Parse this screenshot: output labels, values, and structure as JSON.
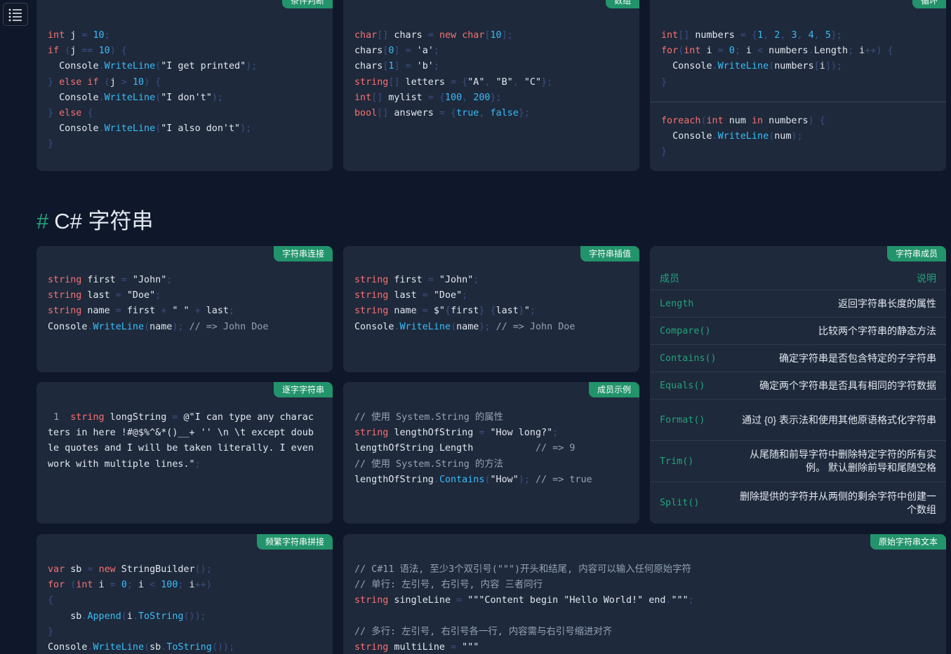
{
  "toolbar": {
    "toc_icon": "list-icon"
  },
  "cards": {
    "conditional": {
      "tag": "条件判断"
    },
    "arrays": {
      "tag": "数组"
    },
    "loops": {
      "tag": "循环"
    },
    "concat": {
      "tag": "字符串连接"
    },
    "interp": {
      "tag": "字符串插值"
    },
    "members": {
      "tag": "字符串成员"
    },
    "verbatim": {
      "tag": "逐字字符串"
    },
    "member_example": {
      "tag": "成员示例"
    },
    "builder": {
      "tag": "频繁字符串拼接"
    },
    "raw": {
      "tag": "原始字符串文本"
    }
  },
  "section": {
    "hash": "#",
    "title": "C# 字符串"
  },
  "member_table": {
    "headers": {
      "member": "成员",
      "desc": "说明"
    },
    "rows": [
      {
        "member": "Length",
        "desc": "返回字符串长度的属性"
      },
      {
        "member": "Compare()",
        "desc": "比较两个字符串的静态方法"
      },
      {
        "member": "Contains()",
        "desc": "确定字符串是否包含特定的子字符串"
      },
      {
        "member": "Equals()",
        "desc": "确定两个字符串是否具有相同的字符数据"
      },
      {
        "member": "Format()",
        "desc": "通过 {0} 表示法和使用其他原语格式化字符串"
      },
      {
        "member": "Trim()",
        "desc": "从尾随和前导字符中删除特定字符的所有实例。 默认删除前导和尾随空格"
      },
      {
        "member": "Split()",
        "desc": "删除提供的字符并从两侧的剩余字符中创建一个数组"
      }
    ]
  },
  "code": {
    "cond": [
      "int j = 10;",
      "if (j == 10) {",
      "  Console.WriteLine(\"I get printed\");",
      "} else if (j > 10) {",
      "  Console.WriteLine(\"I don't\");",
      "} else {",
      "  Console.WriteLine(\"I also don't\");",
      "}"
    ],
    "arr": [
      "char[] chars = new char[10];",
      "chars[0] = 'a';",
      "chars[1] = 'b';",
      "string[] letters = {\"A\", \"B\", \"C\"};",
      "int[] mylist = {100, 200};",
      "bool[] answers = {true, false};"
    ],
    "loop1": [
      "int[] numbers = {1, 2, 3, 4, 5};",
      "for(int i = 0; i < numbers.Length; i++) {",
      "  Console.WriteLine(numbers[i]);",
      "}"
    ],
    "loop2": [
      "foreach(int num in numbers) {",
      "  Console.WriteLine(num);",
      "}"
    ],
    "concat": [
      "string first = \"John\";",
      "string last = \"Doe\";",
      "string name = first + \" \" + last;",
      "Console.WriteLine(name); // => John Doe"
    ],
    "interp": [
      "string first = \"John\";",
      "string last = \"Doe\";",
      "string name = $\"{first} {last}\";",
      "Console.WriteLine(name); // => John Doe"
    ],
    "verbatim_num": "1",
    "verbatim": [
      "string longString = @\"I can type any charac",
      "ters in here !#@$%^&*()__+ '' \\n \\t except doub",
      "le quotes and I will be taken literally. I even",
      "work with multiple lines.\";"
    ],
    "member_example": [
      "// 使用 System.String 的属性",
      "string lengthOfString = \"How long?\";",
      "lengthOfString.Length           // => 9",
      "// 使用 System.String 的方法",
      "lengthOfString.Contains(\"How\"); // => true"
    ],
    "builder": [
      "var sb = new StringBuilder();",
      "for (int i = 0; i < 100; i++)",
      "{",
      "    sb.Append(i.ToString());",
      "}",
      "Console.WriteLine(sb.ToString());"
    ],
    "raw": [
      "// C#11 语法, 至少3个双引号(\"\"\")开头和结尾, 内容可以输入任何原始字符",
      "// 单行: 左引号, 右引号, 内容 三者同行",
      "string singleLine = \"\"\"Content begin \"Hello World!\" end.\"\"\";",
      "",
      "// 多行: 左引号, 右引号各一行, 内容需与右引号缩进对齐",
      "string multiLine = \"\"\""
    ]
  }
}
